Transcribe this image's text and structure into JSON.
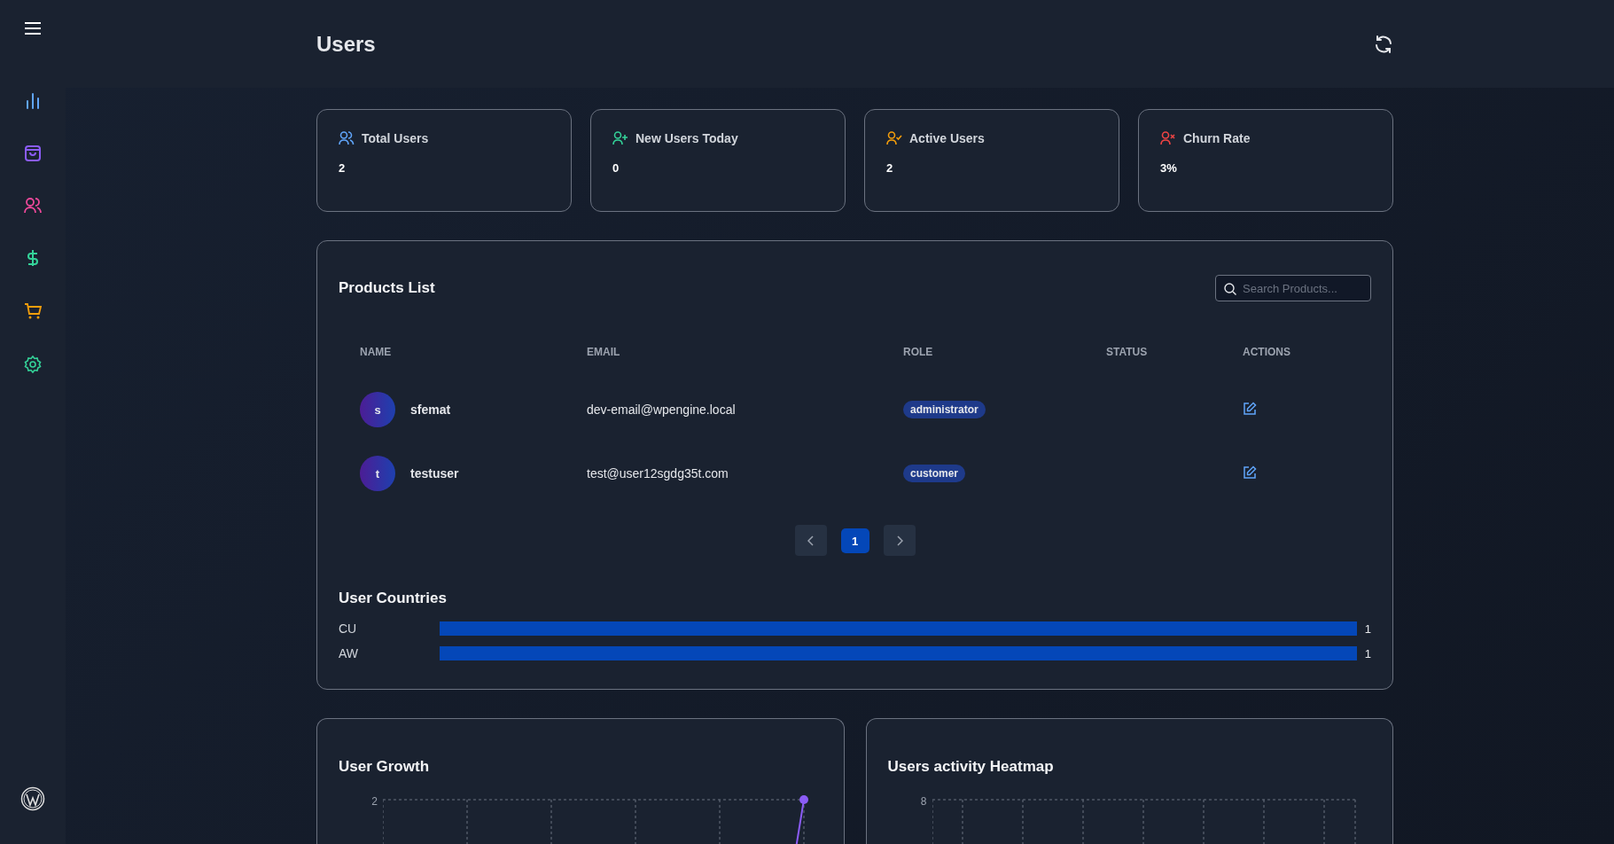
{
  "header": {
    "title": "Users"
  },
  "stats": [
    {
      "kind": "users",
      "label": "Total Users",
      "value": "2"
    },
    {
      "kind": "new",
      "label": "New Users Today",
      "value": "0"
    },
    {
      "kind": "active",
      "label": "Active Users",
      "value": "2"
    },
    {
      "kind": "churn",
      "label": "Churn Rate",
      "value": "3%"
    }
  ],
  "products": {
    "title": "Products List",
    "search": {
      "placeholder": "Search Products..."
    },
    "columns": [
      "NAME",
      "EMAIL",
      "ROLE",
      "STATUS",
      "ACTIONS"
    ],
    "rows": [
      {
        "initial": "s",
        "name": "sfemat",
        "email": "dev-email@wpengine.local",
        "role": "administrator"
      },
      {
        "initial": "t",
        "name": "testuser",
        "email": "test@user12sgdg35t.com",
        "role": "customer"
      }
    ],
    "pages": [
      {
        "label": "1",
        "selected": true
      }
    ]
  },
  "countries": {
    "title": "User Countries",
    "chart_data": {
      "type": "bar",
      "orientation": "horizontal",
      "categories": [
        "CU",
        "AW"
      ],
      "values": [
        1,
        1
      ],
      "data_labels": true
    }
  },
  "growth": {
    "title": "User Growth",
    "y_tick": "2"
  },
  "heatmap": {
    "title": "Users activity Heatmap",
    "y_tick": "8"
  }
}
